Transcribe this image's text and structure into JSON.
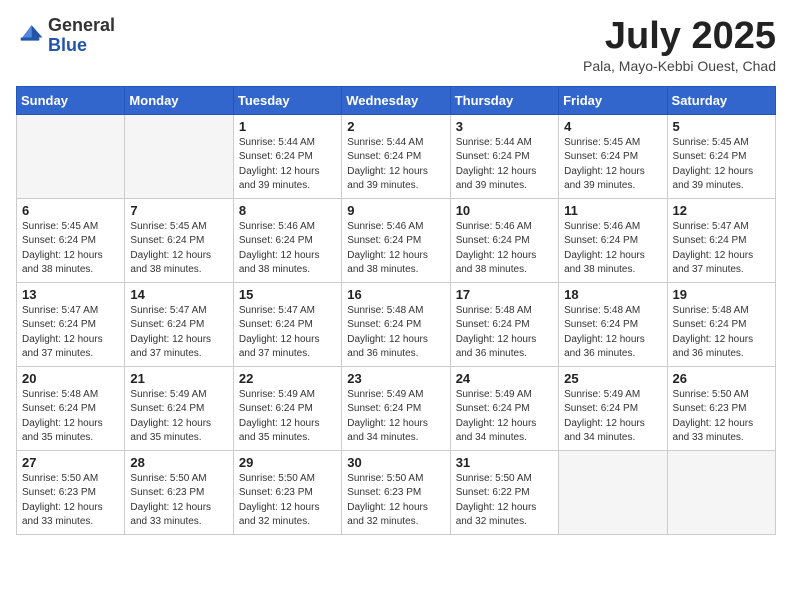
{
  "header": {
    "logo_general": "General",
    "logo_blue": "Blue",
    "month_title": "July 2025",
    "subtitle": "Pala, Mayo-Kebbi Ouest, Chad"
  },
  "weekdays": [
    "Sunday",
    "Monday",
    "Tuesday",
    "Wednesday",
    "Thursday",
    "Friday",
    "Saturday"
  ],
  "weeks": [
    [
      {
        "day": "",
        "info": ""
      },
      {
        "day": "",
        "info": ""
      },
      {
        "day": "1",
        "info": "Sunrise: 5:44 AM\nSunset: 6:24 PM\nDaylight: 12 hours and 39 minutes."
      },
      {
        "day": "2",
        "info": "Sunrise: 5:44 AM\nSunset: 6:24 PM\nDaylight: 12 hours and 39 minutes."
      },
      {
        "day": "3",
        "info": "Sunrise: 5:44 AM\nSunset: 6:24 PM\nDaylight: 12 hours and 39 minutes."
      },
      {
        "day": "4",
        "info": "Sunrise: 5:45 AM\nSunset: 6:24 PM\nDaylight: 12 hours and 39 minutes."
      },
      {
        "day": "5",
        "info": "Sunrise: 5:45 AM\nSunset: 6:24 PM\nDaylight: 12 hours and 39 minutes."
      }
    ],
    [
      {
        "day": "6",
        "info": "Sunrise: 5:45 AM\nSunset: 6:24 PM\nDaylight: 12 hours and 38 minutes."
      },
      {
        "day": "7",
        "info": "Sunrise: 5:45 AM\nSunset: 6:24 PM\nDaylight: 12 hours and 38 minutes."
      },
      {
        "day": "8",
        "info": "Sunrise: 5:46 AM\nSunset: 6:24 PM\nDaylight: 12 hours and 38 minutes."
      },
      {
        "day": "9",
        "info": "Sunrise: 5:46 AM\nSunset: 6:24 PM\nDaylight: 12 hours and 38 minutes."
      },
      {
        "day": "10",
        "info": "Sunrise: 5:46 AM\nSunset: 6:24 PM\nDaylight: 12 hours and 38 minutes."
      },
      {
        "day": "11",
        "info": "Sunrise: 5:46 AM\nSunset: 6:24 PM\nDaylight: 12 hours and 38 minutes."
      },
      {
        "day": "12",
        "info": "Sunrise: 5:47 AM\nSunset: 6:24 PM\nDaylight: 12 hours and 37 minutes."
      }
    ],
    [
      {
        "day": "13",
        "info": "Sunrise: 5:47 AM\nSunset: 6:24 PM\nDaylight: 12 hours and 37 minutes."
      },
      {
        "day": "14",
        "info": "Sunrise: 5:47 AM\nSunset: 6:24 PM\nDaylight: 12 hours and 37 minutes."
      },
      {
        "day": "15",
        "info": "Sunrise: 5:47 AM\nSunset: 6:24 PM\nDaylight: 12 hours and 37 minutes."
      },
      {
        "day": "16",
        "info": "Sunrise: 5:48 AM\nSunset: 6:24 PM\nDaylight: 12 hours and 36 minutes."
      },
      {
        "day": "17",
        "info": "Sunrise: 5:48 AM\nSunset: 6:24 PM\nDaylight: 12 hours and 36 minutes."
      },
      {
        "day": "18",
        "info": "Sunrise: 5:48 AM\nSunset: 6:24 PM\nDaylight: 12 hours and 36 minutes."
      },
      {
        "day": "19",
        "info": "Sunrise: 5:48 AM\nSunset: 6:24 PM\nDaylight: 12 hours and 36 minutes."
      }
    ],
    [
      {
        "day": "20",
        "info": "Sunrise: 5:48 AM\nSunset: 6:24 PM\nDaylight: 12 hours and 35 minutes."
      },
      {
        "day": "21",
        "info": "Sunrise: 5:49 AM\nSunset: 6:24 PM\nDaylight: 12 hours and 35 minutes."
      },
      {
        "day": "22",
        "info": "Sunrise: 5:49 AM\nSunset: 6:24 PM\nDaylight: 12 hours and 35 minutes."
      },
      {
        "day": "23",
        "info": "Sunrise: 5:49 AM\nSunset: 6:24 PM\nDaylight: 12 hours and 34 minutes."
      },
      {
        "day": "24",
        "info": "Sunrise: 5:49 AM\nSunset: 6:24 PM\nDaylight: 12 hours and 34 minutes."
      },
      {
        "day": "25",
        "info": "Sunrise: 5:49 AM\nSunset: 6:24 PM\nDaylight: 12 hours and 34 minutes."
      },
      {
        "day": "26",
        "info": "Sunrise: 5:50 AM\nSunset: 6:23 PM\nDaylight: 12 hours and 33 minutes."
      }
    ],
    [
      {
        "day": "27",
        "info": "Sunrise: 5:50 AM\nSunset: 6:23 PM\nDaylight: 12 hours and 33 minutes."
      },
      {
        "day": "28",
        "info": "Sunrise: 5:50 AM\nSunset: 6:23 PM\nDaylight: 12 hours and 33 minutes."
      },
      {
        "day": "29",
        "info": "Sunrise: 5:50 AM\nSunset: 6:23 PM\nDaylight: 12 hours and 32 minutes."
      },
      {
        "day": "30",
        "info": "Sunrise: 5:50 AM\nSunset: 6:23 PM\nDaylight: 12 hours and 32 minutes."
      },
      {
        "day": "31",
        "info": "Sunrise: 5:50 AM\nSunset: 6:22 PM\nDaylight: 12 hours and 32 minutes."
      },
      {
        "day": "",
        "info": ""
      },
      {
        "day": "",
        "info": ""
      }
    ]
  ]
}
